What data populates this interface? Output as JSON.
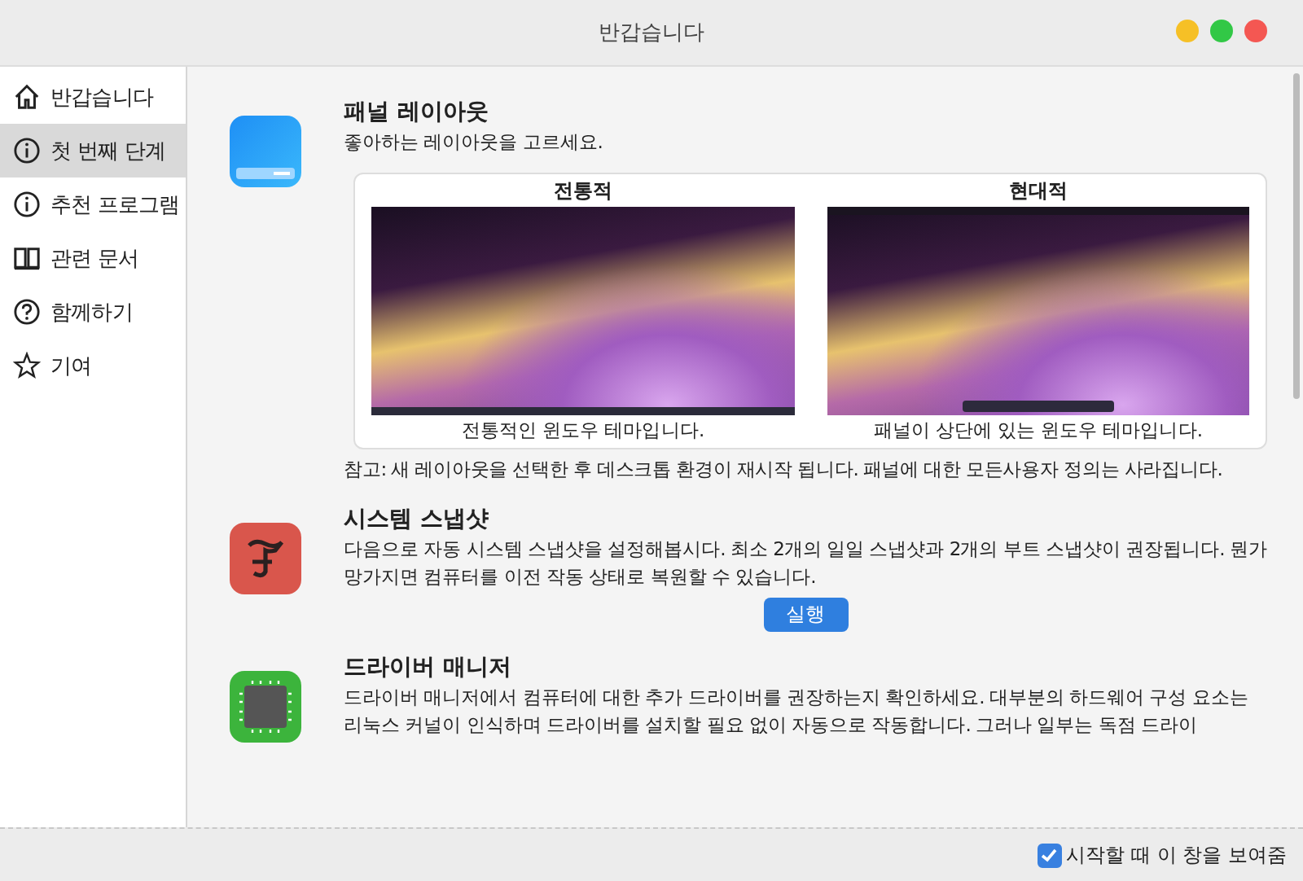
{
  "window": {
    "title": "반갑습니다"
  },
  "sidebar": {
    "items": [
      {
        "label": "반갑습니다",
        "selected": false
      },
      {
        "label": "첫 번째 단계",
        "selected": true
      },
      {
        "label": "추천 프로그램",
        "selected": false
      },
      {
        "label": "관련 문서",
        "selected": false
      },
      {
        "label": "함께하기",
        "selected": false
      },
      {
        "label": "기여",
        "selected": false
      }
    ]
  },
  "sections": [
    {
      "title": "패널 레이아웃",
      "description": "좋아하는 레이아웃을 고르세요.",
      "layouts": [
        {
          "name": "전통적",
          "caption": "전통적인 윈도우 테마입니다.",
          "kind": "bottom"
        },
        {
          "name": "현대적",
          "caption": "패널이 상단에 있는 윈도우 테마입니다.",
          "kind": "top"
        }
      ],
      "note": "참고: 새 레이아웃을 선택한 후 데스크톱 환경이 재시작 됩니다. 패널에 대한 모든사용자 정의는 사라집니다."
    },
    {
      "title": "시스템 스냅샷",
      "description": "다음으로 자동 시스템 스냅샷을 설정해봅시다. 최소 2개의 일일 스냅샷과 2개의 부트 스냅샷이 권장됩니다. 뭔가 망가지면 컴퓨터를 이전 작동 상태로 복원할 수 있습니다.",
      "button": "실행"
    },
    {
      "title": "드라이버 매니저",
      "description": "드라이버 매니저에서 컴퓨터에 대한 추가 드라이버를 권장하는지 확인하세요. 대부분의 하드웨어 구성 요소는 리눅스 커널이 인식하며 드라이버를 설치할 필요 없이 자동으로 작동합니다. 그러나 일부는 독점 드라이"
    }
  ],
  "footer": {
    "checkbox": {
      "label": "시작할 때 이 창을 보여줌",
      "checked": true
    }
  }
}
